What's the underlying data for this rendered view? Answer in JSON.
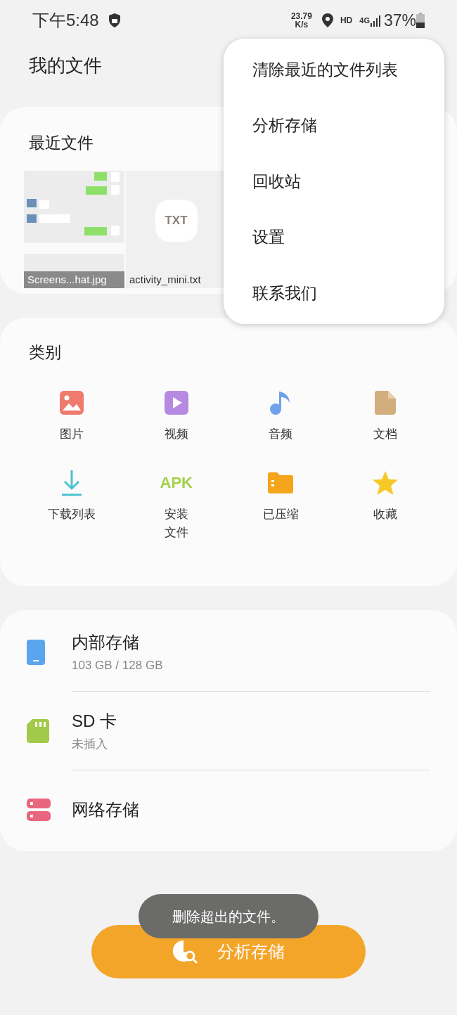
{
  "status_bar": {
    "time": "下午5:48",
    "speed_value": "23.79",
    "speed_unit": "K/s",
    "hd": "HD",
    "network": "4G",
    "battery": "37%"
  },
  "title": "我的文件",
  "recent": {
    "heading": "最近文件",
    "files": [
      {
        "name": "Screens...hat.jpg",
        "kind": "picture"
      },
      {
        "name": "activity_mini.txt",
        "kind": "txt",
        "badge": "TXT"
      }
    ]
  },
  "categories": {
    "heading": "类别",
    "items": [
      {
        "label": "图片"
      },
      {
        "label": "视频"
      },
      {
        "label": "音频"
      },
      {
        "label": "文档"
      },
      {
        "label": "下载列表"
      },
      {
        "label": "安装文件",
        "badge": "APK"
      },
      {
        "label": "已压缩"
      },
      {
        "label": "收藏"
      }
    ]
  },
  "storage": [
    {
      "name": "内部存储",
      "detail": "103 GB / 128 GB"
    },
    {
      "name": "SD 卡",
      "detail": "未插入"
    },
    {
      "name": "网络存储"
    }
  ],
  "menu": [
    "清除最近的文件列表",
    "分析存储",
    "回收站",
    "设置",
    "联系我们"
  ],
  "toast": "删除超出的文件。",
  "analyze_button": "分析存储"
}
